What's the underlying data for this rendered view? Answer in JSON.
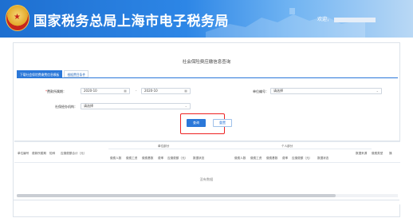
{
  "header": {
    "site_title": "国家税务总局上海市电子税务局",
    "welcome_prefix": "欢迎，"
  },
  "page": {
    "title": "社会保险费应缴信息查询",
    "tabs": [
      {
        "label": "下载社会保险费缴费信息模板"
      },
      {
        "label": "根据费目条件"
      }
    ]
  },
  "form": {
    "period_label": "费款所属期",
    "period_from": "2020-10",
    "period_to": "2020-10",
    "unit_no_label": "单位编号",
    "unit_no_value": "请选择",
    "agency_label": "社保经办机构",
    "agency_value": "请选择",
    "query_button": "查询",
    "reset_button": "重置"
  },
  "table": {
    "columns": [
      "单位编号",
      "费款所属期",
      "险种",
      "应缴费额合计（元）"
    ],
    "unit_group": "单位部分",
    "personal_group": "个人部分",
    "unit_sub": [
      "缴费人数",
      "缴费工资",
      "缴费基数",
      "费率",
      "应缴费额（元）",
      "数据状态"
    ],
    "personal_sub": [
      "缴费人数",
      "缴费工资",
      "缴费基数",
      "费率",
      "应缴费额（元）",
      "数据状态"
    ],
    "tail_columns": [
      "数据来源",
      "缴费类型",
      "操"
    ],
    "empty_text": "没有数据"
  }
}
